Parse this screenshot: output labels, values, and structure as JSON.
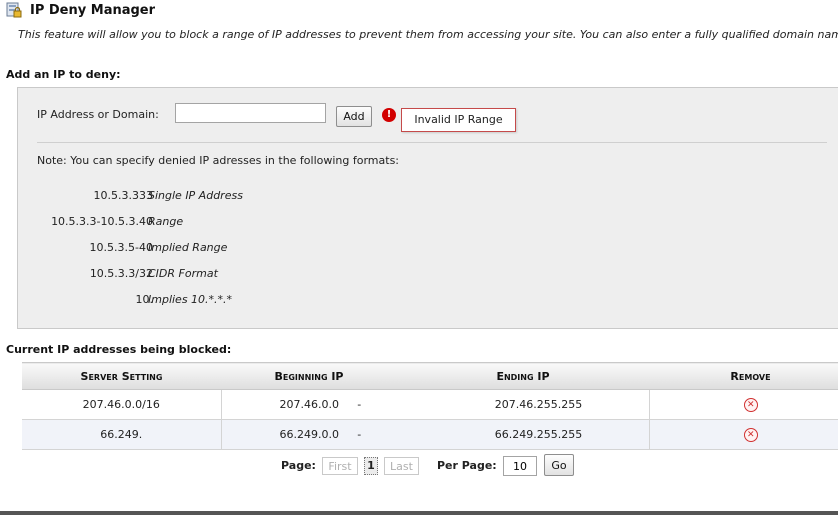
{
  "header": {
    "title": "IP Deny Manager",
    "icon": "ip-deny-manager-icon"
  },
  "description": "This feature will allow you to block a range of IP addresses to prevent them from accessing your site. You can also enter a fully qualified domain name, and the IP Deny Manager will attempt to resolve it to an IP address for you.",
  "add_section": {
    "heading": "Add an IP to deny:",
    "field_label": "IP Address or Domain:",
    "input_value": "",
    "add_button": "Add",
    "error_icon": "!",
    "error_message": "Invalid IP Range",
    "note": "Note: You can specify denied IP adresses in the following formats:",
    "formats": [
      {
        "example": "10.5.3.333",
        "description": "Single IP Address"
      },
      {
        "example": "10.5.3.3-10.5.3.40",
        "description": "Range"
      },
      {
        "example": "10.5.3.5-40",
        "description": "Implied Range"
      },
      {
        "example": "10.5.3.3/32",
        "description": "CIDR Format"
      },
      {
        "example": "10.",
        "description": "Implies 10.*.*.*"
      }
    ]
  },
  "blocked_section": {
    "heading": "Current IP addresses being blocked:",
    "columns": [
      "Server Setting",
      "Beginning IP",
      "Ending IP",
      "Remove"
    ],
    "separator": "-",
    "rows": [
      {
        "server_setting": "207.46.0.0/16",
        "beginning_ip": "207.46.0.0",
        "ending_ip": "207.46.255.255"
      },
      {
        "server_setting": "66.249.",
        "beginning_ip": "66.249.0.0",
        "ending_ip": "66.249.255.255"
      }
    ],
    "remove_icon": "remove-icon"
  },
  "pager": {
    "page_label": "Page:",
    "first": "First",
    "current": "1",
    "last": "Last",
    "per_page_label": "Per Page:",
    "per_page_value": "10",
    "go_button": "Go"
  }
}
